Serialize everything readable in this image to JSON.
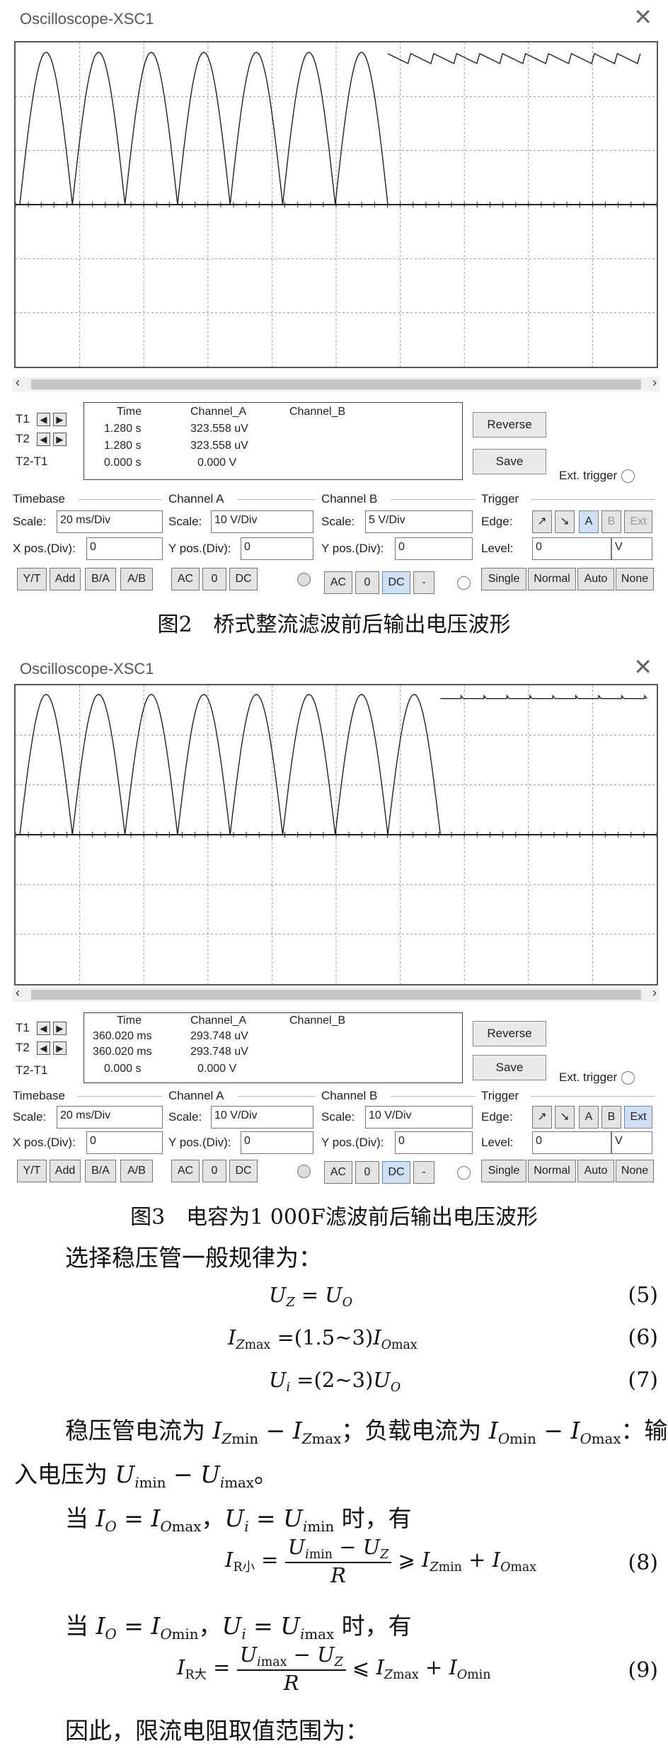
{
  "scope1": {
    "title": "Oscilloscope-XSC1",
    "t1_label": "T1",
    "t2_label": "T2",
    "t2t1_label": "T2-T1",
    "hdr_time": "Time",
    "hdr_cha": "Channel_A",
    "hdr_chb": "Channel_B",
    "t1_time": "1.280 s",
    "t1_cha": "323.558 uV",
    "t2_time": "1.280 s",
    "t2_cha": "323.558 uV",
    "d_time": "0.000 s",
    "d_cha": "0.000 V",
    "reverse": "Reverse",
    "save": "Save",
    "ext_trigger": "Ext. trigger",
    "timebase": "Timebase",
    "channel_a": "Channel A",
    "channel_b": "Channel B",
    "trigger": "Trigger",
    "scale_label": "Scale:",
    "xpos_label": "X pos.(Div):",
    "ypos_label": "Y pos.(Div):",
    "edge_label": "Edge:",
    "level_label": "Level:",
    "tb_scale": "20 ms/Div",
    "tb_xpos": "0",
    "cha_scale": "10  V/Div",
    "cha_ypos": "0",
    "chb_scale": "5  V/Div",
    "chb_ypos": "0",
    "level": "0",
    "level_unit": "V",
    "yt": "Y/T",
    "add": "Add",
    "ba": "B/A",
    "ab": "A/B",
    "ac": "AC",
    "zero": "0",
    "dc": "DC",
    "minus": "-",
    "edge_rise": "↗",
    "edge_fall": "↘",
    "trig_a": "A",
    "trig_b": "B",
    "trig_ext": "Ext",
    "single": "Single",
    "normal": "Normal",
    "auto": "Auto",
    "none": "None"
  },
  "caption2": "图2　桥式整流滤波前后输出电压波形",
  "scope2": {
    "title": "Oscilloscope-XSC1",
    "t1_label": "T1",
    "t2_label": "T2",
    "t2t1_label": "T2-T1",
    "hdr_time": "Time",
    "hdr_cha": "Channel_A",
    "hdr_chb": "Channel_B",
    "t1_time": "360.020 ms",
    "t1_cha": "293.748 uV",
    "t2_time": "360.020 ms",
    "t2_cha": "293.748 uV",
    "d_time": "0.000 s",
    "d_cha": "0.000 V",
    "reverse": "Reverse",
    "save": "Save",
    "ext_trigger": "Ext. trigger",
    "timebase": "Timebase",
    "channel_a": "Channel A",
    "channel_b": "Channel B",
    "trigger": "Trigger",
    "scale_label": "Scale:",
    "xpos_label": "X pos.(Div):",
    "ypos_label": "Y pos.(Div):",
    "edge_label": "Edge:",
    "level_label": "Level:",
    "tb_scale": "20 ms/Div",
    "tb_xpos": "0",
    "cha_scale": "10  V/Div",
    "cha_ypos": "0",
    "chb_scale": "10  V/Div",
    "chb_ypos": "0",
    "level": "0",
    "level_unit": "V",
    "yt": "Y/T",
    "add": "Add",
    "ba": "B/A",
    "ab": "A/B",
    "ac": "AC",
    "zero": "0",
    "dc": "DC",
    "minus": "-",
    "edge_rise": "↗",
    "edge_fall": "↘",
    "trig_a": "A",
    "trig_b": "B",
    "trig_ext": "Ext",
    "single": "Single",
    "normal": "Normal",
    "auto": "Auto",
    "none": "None"
  },
  "caption3": "图3　电容为1 000F滤波前后输出电压波形",
  "body": {
    "intro": "选择稳压管一般规律为：",
    "eq5": "(5)",
    "eq6": "(6)",
    "eq7": "(7)",
    "eq8": "(8)",
    "eq9": "(9)",
    "p1_a": "稳压管电流为",
    "p1_b": "；负载电流为",
    "p1_c": "：输",
    "p1_d": "入电压为",
    "p1_e": "。",
    "when": "当",
    "comma": "，",
    "have": "时，有",
    "sub_small": "R小",
    "sub_big": "R大",
    "concl": "因此，限流电阻取值范围为："
  },
  "colors": {
    "trace": "#222222",
    "grid": "#999999",
    "active_btn": "#cfe0f5"
  },
  "icons": {
    "close": "close-icon",
    "arrow_left": "arrow-left-icon",
    "arrow_right": "arrow-right-icon"
  }
}
